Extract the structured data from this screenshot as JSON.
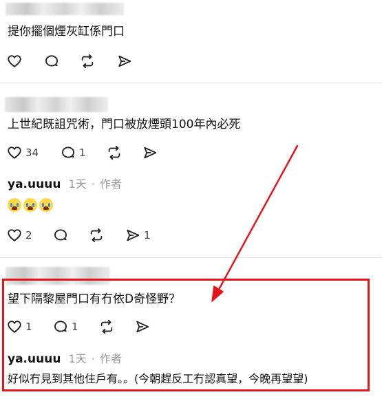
{
  "posts": [
    {
      "text": "提你擺個煙灰缸係門口",
      "counts": {
        "like": "",
        "reply": "",
        "send": ""
      }
    },
    {
      "text": "上世紀既詛咒術，門口被放煙頭100年內必死",
      "counts": {
        "like": "34",
        "reply": "1",
        "send": ""
      }
    },
    {
      "author": "ya.uuuu",
      "time": "1天",
      "dot": "·",
      "role": "作者",
      "emoji_alt": "😭😭😭",
      "counts": {
        "like": "2",
        "reply": "",
        "send": "1"
      }
    },
    {
      "text": "望下隔黎屋門口有冇依D奇怪野？",
      "counts": {
        "like": "1",
        "reply": "1",
        "send": ""
      }
    },
    {
      "author": "ya.uuuu",
      "time": "1天",
      "dot": "·",
      "role": "作者",
      "text": "好似冇見到其他住戶有。。(今朝趕反工冇認真望，今晚再望望)"
    }
  ],
  "colors": {
    "highlight": "#e8141b",
    "arrow": "#e8141b",
    "meta": "#9a9a9a"
  },
  "icons": [
    "heart-icon",
    "comment-icon",
    "repost-icon",
    "send-icon"
  ]
}
